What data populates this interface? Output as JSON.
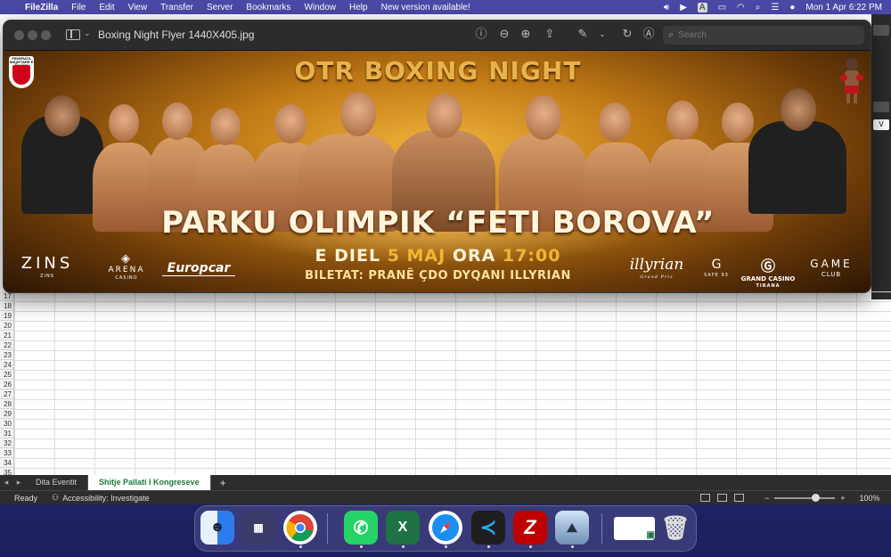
{
  "menubar": {
    "app_name": "FileZilla",
    "items": [
      "File",
      "Edit",
      "View",
      "Transfer",
      "Server",
      "Bookmarks",
      "Window",
      "Help",
      "New version available!"
    ],
    "input_source": "A",
    "clock": "Mon 1 Apr  6:22 PM"
  },
  "preview": {
    "filename": "Boxing Night Flyer 1440X405.jpg",
    "search_placeholder": "Search",
    "poster": {
      "title": "OTR BOXING NIGHT",
      "venue": "PARKU OLIMPIK “FETI BOROVA”",
      "date_prefix": "E DIEL",
      "date_highlight": "5 MAJ",
      "date_mid": "ORA",
      "date_time": "17:00",
      "tickets": "BILETAT: PRANË ÇDO DYQANI ILLYRIAN",
      "federation_badge_text": "FEDERATA SHQIPTARE E BOKSIT",
      "sponsors_left": [
        {
          "name": "ZINS",
          "sub": "ZINS"
        },
        {
          "name": "ARENA",
          "sub": "CASINO"
        },
        {
          "name": "Europcar",
          "sub": ""
        }
      ],
      "sponsors_right": [
        {
          "name": "illyrian",
          "sub": "Grand Prix"
        },
        {
          "name": "G",
          "sub": "SAFE 93"
        },
        {
          "name": "GRAND CASINO",
          "sub": "TIRANA"
        },
        {
          "name": "GAME",
          "sub": "CLUB"
        }
      ]
    }
  },
  "excel": {
    "row_numbers": [
      "17",
      "18",
      "19",
      "20",
      "21",
      "22",
      "23",
      "24",
      "25",
      "26",
      "27",
      "28",
      "29",
      "30",
      "31",
      "32",
      "33",
      "34",
      "35"
    ],
    "side_box_label": "V",
    "sheet_tabs": [
      "Dita Eventit",
      "Shitje Pallati I Kongreseve"
    ],
    "active_tab": "Shitje Pallati I Kongreseve",
    "add_sheet": "+",
    "status_ready": "Ready",
    "accessibility": "Accessibility: Investigate",
    "zoom_minus": "−",
    "zoom_plus": "+",
    "zoom": "100%"
  },
  "dock": {
    "apps": [
      "Finder",
      "Launchpad",
      "Chrome",
      "WhatsApp",
      "Excel",
      "Safari",
      "VS Code",
      "FileZilla",
      "Preview",
      "Excel Window",
      "Trash"
    ]
  },
  "colors": {
    "accent_gold": "#f2b534",
    "excel_green": "#1d7a3a",
    "desktop": "#2b2f7d"
  }
}
